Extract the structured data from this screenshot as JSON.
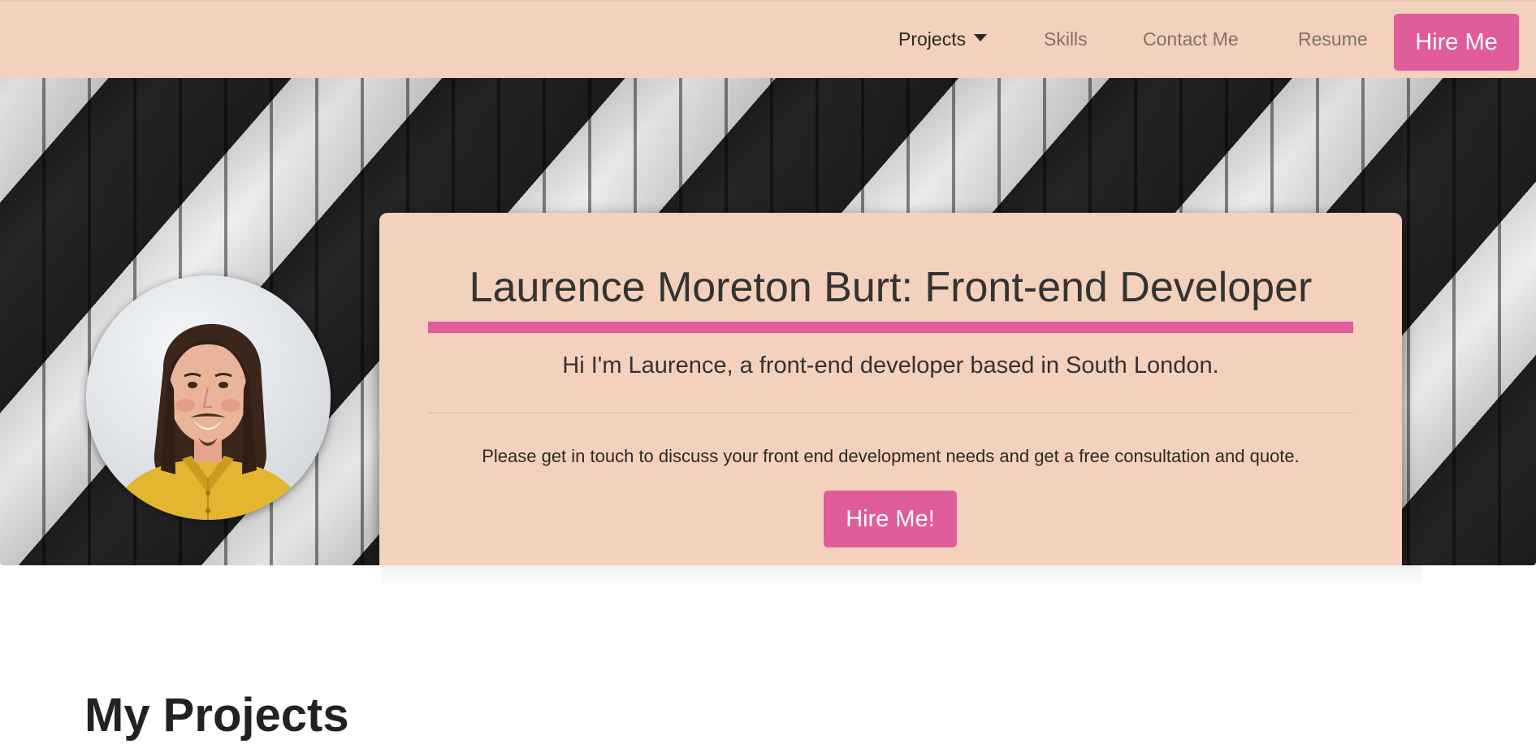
{
  "nav": {
    "projects_label": "Projects",
    "skills_label": "Skills",
    "contact_label": "Contact Me",
    "resume_label": "Resume",
    "hire_label": "Hire Me"
  },
  "hero": {
    "title": "Laurence Moreton Burt: Front-end Developer",
    "subtitle": "Hi I'm Laurence, a front-end developer based in South London.",
    "text": "Please get in touch to discuss your front end development needs and get a free consultation and quote.",
    "hire_label": "Hire Me!"
  },
  "projects": {
    "heading": "My Projects"
  },
  "colors": {
    "nav_bg": "#f3d1bc",
    "accent": "#e05c9a",
    "card_bg": "#f3d1bc",
    "text_dark": "#333333"
  },
  "icons": {
    "dropdown": "caret-down-icon"
  }
}
